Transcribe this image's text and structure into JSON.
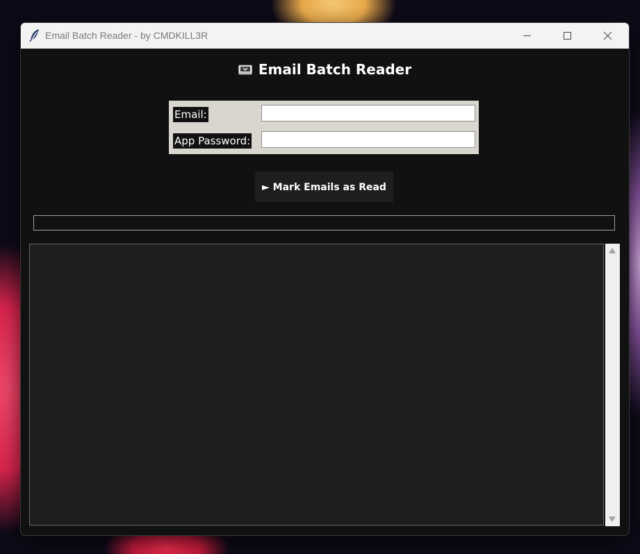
{
  "window": {
    "title": "Email Batch Reader - by CMDKILL3R",
    "app_icon": "feather-icon",
    "controls": [
      "minimize-icon",
      "maximize-icon",
      "close-icon"
    ]
  },
  "header": {
    "icon": "inbox-tray-icon",
    "title": "Email Batch Reader"
  },
  "form": {
    "email_label": "Email:",
    "email_value": "",
    "password_label": "App Password:",
    "password_value": ""
  },
  "actions": {
    "run_label": "► Mark Emails as Read"
  },
  "progress": {
    "value_percent": 0
  },
  "log": {
    "text": ""
  },
  "colors": {
    "window_bg": "#111111",
    "form_bg": "#d8d6cf",
    "button_bg": "#1e1e1e",
    "log_bg": "#1e1e1e",
    "text": "#ffffff"
  }
}
